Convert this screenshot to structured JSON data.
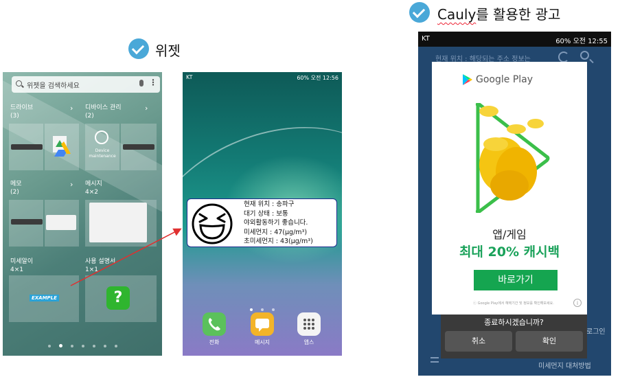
{
  "headings": {
    "widget": "위젯",
    "cauly_prefix": "Cauly",
    "cauly_suffix": "를 활용한 광고"
  },
  "colors": {
    "check": "#4aa8d8",
    "arrow": "#e03030",
    "ad_green": "#15a550",
    "app_bg": "#22476e"
  },
  "screen1": {
    "search_placeholder": "위젯을 검색하세요",
    "widgets": [
      {
        "title": "드라이브",
        "count": "(3)"
      },
      {
        "title": "디바이스 관리",
        "count": "(2)"
      },
      {
        "title": "메모",
        "count": "(2)"
      },
      {
        "title": "메시지",
        "count": "4×2"
      },
      {
        "title": "미세알이",
        "count": "4×1"
      },
      {
        "title": "사용 설명서",
        "count": "1×1"
      }
    ],
    "device_tile_text": "Device\nmaintenance",
    "example_text": "EXAMPLE",
    "help_icon": "?"
  },
  "screen2": {
    "status_left": "KT",
    "status_right": "60% 오전 12:56",
    "widget_lines": [
      "현재 위치 : 송파구",
      "대기 상태 : 보통",
      "야외활동하기 좋습니다.",
      "미세먼지 : 47(μg/m³)",
      "초미세먼지 : 43(μg/m³)"
    ],
    "dock": [
      {
        "label": "전화",
        "icon": "phone-icon",
        "color": "#5bc15b"
      },
      {
        "label": "메시지",
        "icon": "message-icon",
        "color": "#f3b429"
      },
      {
        "label": "앱스",
        "icon": "apps-grid-icon",
        "color": "#f4f4f4"
      }
    ]
  },
  "screen3": {
    "status_left": "KT",
    "status_right": "60% 오전 12:55",
    "appbar_title": "현재 위치 :  해당되는 주소 정보는",
    "ad": {
      "brand": "Google Play",
      "title": "앱/게임",
      "subtitle": "최대 20% 캐시백",
      "button": "바로가기",
      "fine_print": "ⓒ Google Play에서 혜택기간 및 정보를 확인해보세요."
    },
    "exit_question": "종료하시겠습니까?",
    "cancel_label": "취소",
    "confirm_label": "확인",
    "bg_login": "로그인",
    "bg_bottom": "미세먼지 대처방법"
  }
}
